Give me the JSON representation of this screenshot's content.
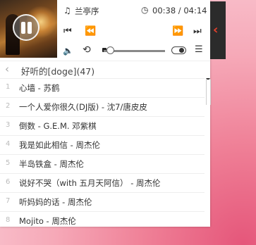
{
  "now_playing": {
    "title": "兰亭序",
    "current_time": "00:38",
    "total_time": "04:14",
    "time_display": "00:38 / 04:14"
  },
  "controls": {
    "note_glyph": "♫",
    "clock_glyph": "◷",
    "skip_back_glyph": "⏮",
    "rewind_glyph": "⏪",
    "forward_glyph": "⏩",
    "skip_forward_glyph": "⏭",
    "volume_glyph": "🔈",
    "repeat_glyph": "⟲",
    "list_glyph": "☰",
    "side_arrow_glyph": "‹",
    "volume_level": 0.06
  },
  "playlist": {
    "back_glyph": "‹",
    "name": "好听的[doge](47)",
    "songs": [
      {
        "num": "1",
        "text": "心墙 - 苏鹤"
      },
      {
        "num": "2",
        "text": "一个人爱你很久(DJ版) - 沈7/唐皮皮"
      },
      {
        "num": "3",
        "text": "倒数 - G.E.M. 邓紫棋"
      },
      {
        "num": "4",
        "text": "我是如此相信 - 周杰伦"
      },
      {
        "num": "5",
        "text": "半岛铁盒 - 周杰伦"
      },
      {
        "num": "6",
        "text": "说好不哭（with 五月天阿信） - 周杰伦"
      },
      {
        "num": "7",
        "text": "听妈妈的话 - 周杰伦"
      },
      {
        "num": "8",
        "text": "Mojito - 周杰伦"
      }
    ]
  },
  "colors": {
    "accent_arrow": "#e8412c",
    "side_tab": "#2b2b2b"
  }
}
